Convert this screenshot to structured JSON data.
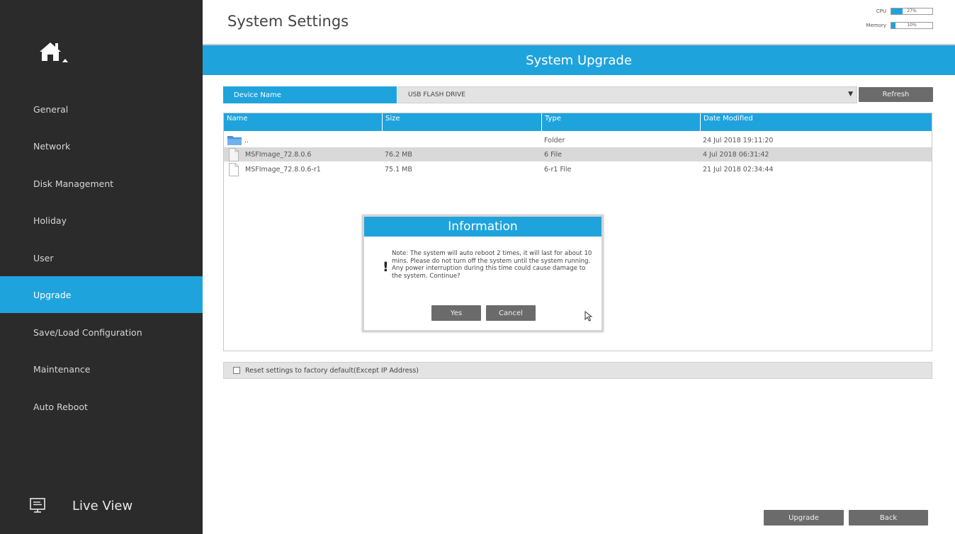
{
  "sidebar": {
    "items": [
      {
        "label": "General"
      },
      {
        "label": "Network"
      },
      {
        "label": "Disk Management"
      },
      {
        "label": "Holiday"
      },
      {
        "label": "User"
      },
      {
        "label": "Upgrade"
      },
      {
        "label": "Save/Load Configuration"
      },
      {
        "label": "Maintenance"
      },
      {
        "label": "Auto Reboot"
      }
    ],
    "active_item": "Upgrade",
    "live_view_label": "Live View",
    "icons": [
      "home-icon",
      "monitor-icon"
    ]
  },
  "header": {
    "title": "System Settings",
    "cpu_label": "CPU",
    "cpu_value": "27%",
    "cpu_fraction": 0.27,
    "memory_label": "Memory",
    "memory_value": "10%",
    "memory_fraction": 0.1
  },
  "section": {
    "title": "System Upgrade"
  },
  "device": {
    "label": "Device Name",
    "selected": "USB FLASH DRIVE",
    "refresh_label": "Refresh"
  },
  "file_table": {
    "columns": [
      "Name",
      "Size",
      "Type",
      "Date Modified"
    ],
    "rows": [
      {
        "name": "..",
        "size": "",
        "type": "Folder",
        "date": "24 Jul 2018 19:11:20",
        "icon": "folder-icon"
      },
      {
        "name": "MSFImage_72.8.0.6",
        "size": "76.2 MB",
        "type": "6 File",
        "date": "4 Jul 2018 06:31:42",
        "icon": "file-icon",
        "selected": true
      },
      {
        "name": "MSFImage_72.8.0.6-r1",
        "size": "75.1 MB",
        "type": "6-r1 File",
        "date": "21 Jul 2018 02:34:44",
        "icon": "file-icon"
      }
    ]
  },
  "reset": {
    "label": "Reset settings to factory default(Except IP Address)",
    "checked": false
  },
  "footer": {
    "upgrade_label": "Upgrade",
    "back_label": "Back"
  },
  "modal": {
    "title": "Information",
    "icon_glyph": "!",
    "message": "Note: The system will auto reboot 2 times, it will last for about 10 mins. Please do not turn off the system until the system running. Any power interruption during this time could cause damage to the system. Continue?",
    "yes_label": "Yes",
    "cancel_label": "Cancel"
  },
  "colors": {
    "accent": "#1fa3dd",
    "sidebar_bg": "#2b2b2b",
    "button_bg": "#6b6b6b"
  }
}
